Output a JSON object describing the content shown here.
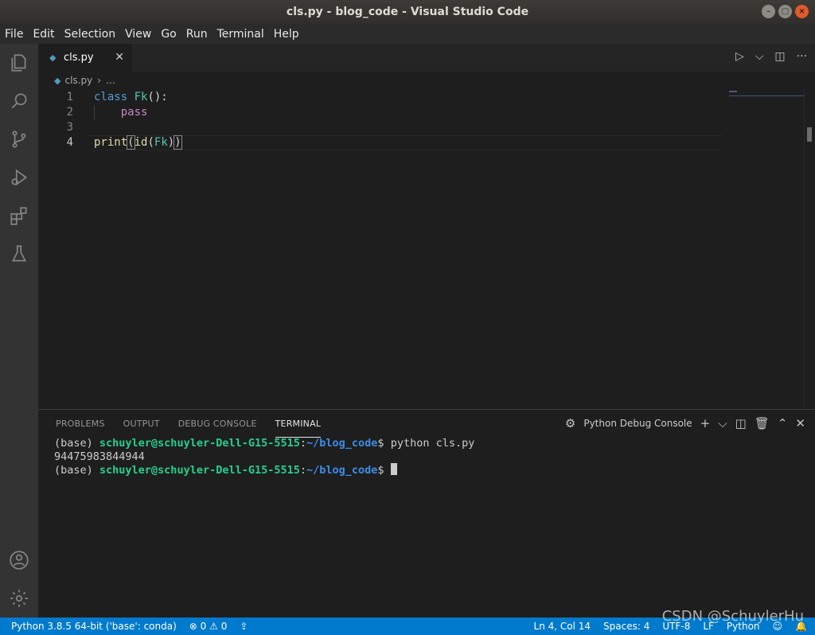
{
  "window": {
    "title": "cls.py - blog_code - Visual Studio Code",
    "minimize": "–",
    "maximize": "□",
    "close": "×"
  },
  "menu": [
    "File",
    "Edit",
    "Selection",
    "View",
    "Go",
    "Run",
    "Terminal",
    "Help"
  ],
  "tab": {
    "label": "cls.py",
    "close": "✕"
  },
  "breadcrumb": {
    "file": "cls.py",
    "more": "…"
  },
  "editor_actions": {
    "run": "▷",
    "run_menu": "⌵",
    "split": "◫",
    "more": "···"
  },
  "code": {
    "lines": [
      {
        "no": "1",
        "text": "class Fk():"
      },
      {
        "no": "2",
        "text": "    pass"
      },
      {
        "no": "3",
        "text": ""
      },
      {
        "no": "4",
        "text": "print(id(Fk))"
      }
    ]
  },
  "panel": {
    "tabs": [
      "PROBLEMS",
      "OUTPUT",
      "DEBUG CONSOLE",
      "TERMINAL"
    ],
    "active_tab": "TERMINAL",
    "terminal_select": "Python Debug Console",
    "actions": {
      "add": "+",
      "add_menu": "⌵",
      "split": "◫",
      "trash": "🗑",
      "maximize": "⌃",
      "close": "✕"
    }
  },
  "terminal": {
    "prompt_prefix": "(base) ",
    "user": "schuyler@schuyler-Dell-G15-5515",
    "colon": ":",
    "path": "~/blog_code",
    "dollar": "$",
    "command": " python cls.py",
    "output": "94475983844944"
  },
  "status": {
    "interpreter": "Python 3.8.5 64-bit ('base': conda)",
    "errors": "⊗ 0",
    "warnings": "⚠ 0",
    "position": "Ln 4, Col 14",
    "spaces": "Spaces: 4",
    "encoding": "UTF-8",
    "eol": "LF",
    "language": "Python"
  },
  "watermark": "CSDN @SchuylerHu",
  "colors": {
    "accent": "#007acc",
    "terminal_user": "#23d18b",
    "terminal_path": "#3b8eea"
  }
}
